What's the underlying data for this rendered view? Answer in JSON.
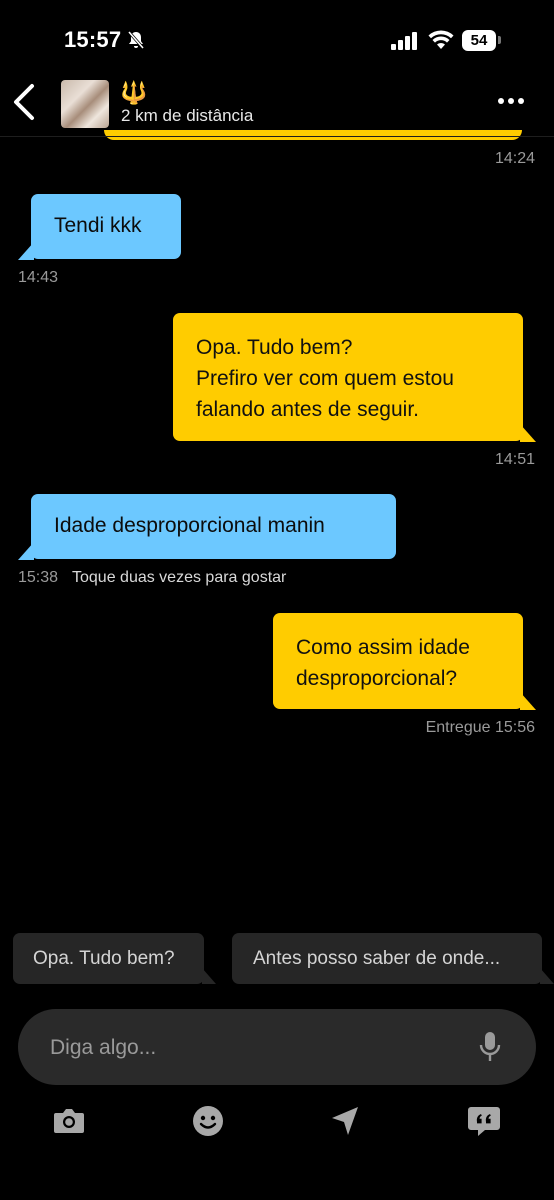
{
  "status_bar": {
    "time": "15:57",
    "battery": "54"
  },
  "header": {
    "emoji": "🔱",
    "distance": "2 km de distância"
  },
  "messages": [
    {
      "direction": "out",
      "timestamp": "14:24"
    },
    {
      "direction": "in",
      "text": "Tendi kkk",
      "timestamp": "14:43"
    },
    {
      "direction": "out",
      "lines": [
        "Opa. Tudo bem?",
        "Prefiro ver com quem estou",
        "falando antes de seguir."
      ],
      "timestamp": "14:51"
    },
    {
      "direction": "in",
      "text": "Idade desproporcional manin",
      "timestamp": "15:38",
      "hint": "Toque duas vezes para gostar"
    },
    {
      "direction": "out",
      "lines": [
        "Como assim idade",
        "desproporcional?"
      ],
      "timestamp": "Entregue 15:56"
    }
  ],
  "quick_replies": [
    "Opa. Tudo bem?",
    "Antes posso saber de onde..."
  ],
  "input": {
    "placeholder": "Diga algo..."
  },
  "toolbar_icons": [
    "camera-icon",
    "emoji-icon",
    "location-icon",
    "saved-phrases-icon"
  ],
  "colors": {
    "incoming": "#6cc8ff",
    "outgoing": "#ffcc00",
    "background": "#000000"
  }
}
